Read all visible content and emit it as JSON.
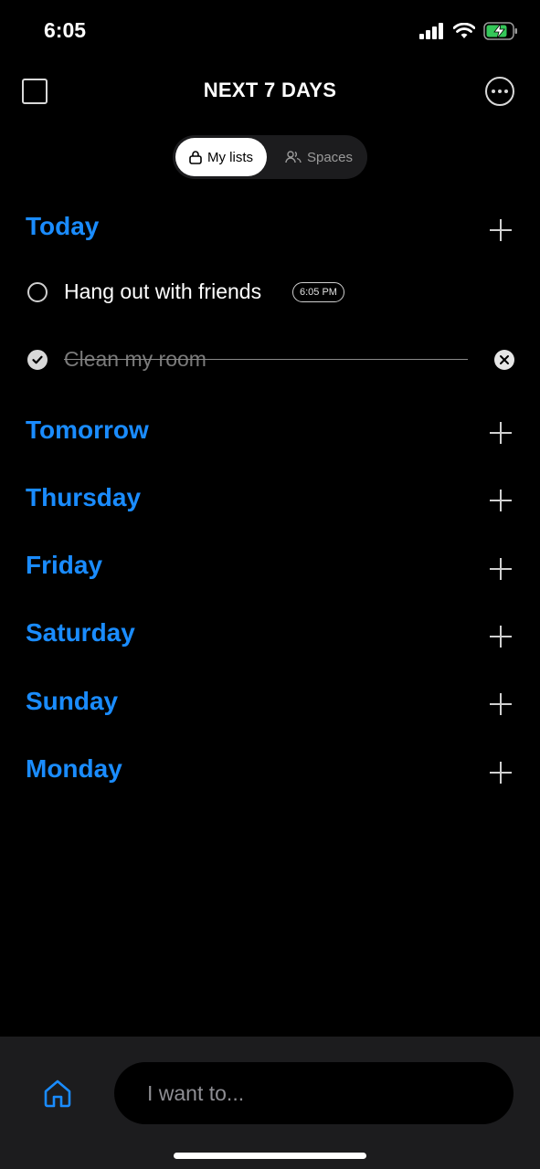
{
  "status_bar": {
    "time": "6:05"
  },
  "header": {
    "title": "NEXT 7 DAYS"
  },
  "tabs": [
    {
      "label": "My lists",
      "icon": "lock-icon",
      "selected": true
    },
    {
      "label": "Spaces",
      "icon": "people-icon",
      "selected": false
    }
  ],
  "sections": [
    {
      "title": "Today"
    },
    {
      "title": "Tomorrow"
    },
    {
      "title": "Thursday"
    },
    {
      "title": "Friday"
    },
    {
      "title": "Saturday"
    },
    {
      "title": "Sunday"
    },
    {
      "title": "Monday"
    }
  ],
  "tasks": [
    {
      "text": "Hang out with friends",
      "time": "6:05 PM",
      "completed": false
    },
    {
      "text": "Clean my room",
      "completed": true
    }
  ],
  "input": {
    "placeholder": "I want to..."
  },
  "colors": {
    "accent": "#1a8cff",
    "background": "#000000",
    "bottom_bar": "#1c1c1e"
  }
}
